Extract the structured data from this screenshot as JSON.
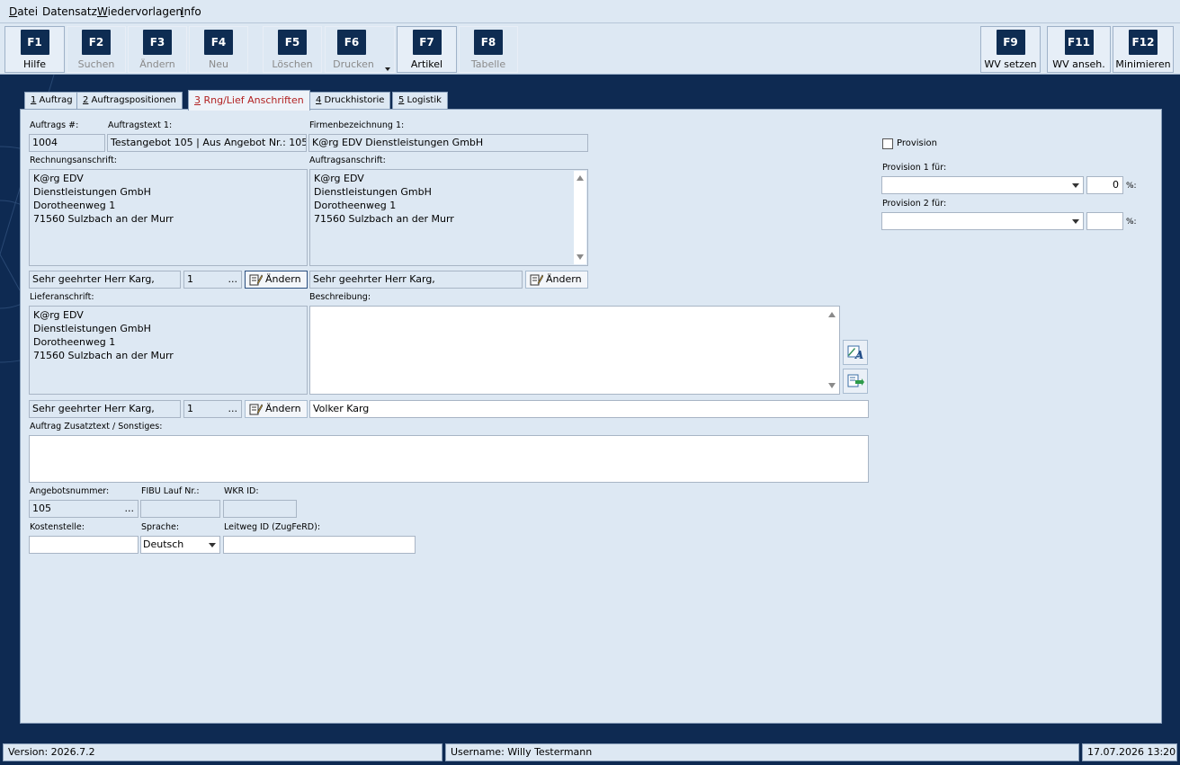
{
  "menu": {
    "items": [
      {
        "hot": "D",
        "rest": "atei"
      },
      {
        "hot": "",
        "rest": "Datensatz"
      },
      {
        "hot": "W",
        "rest": "iedervorlagen"
      },
      {
        "hot": "I",
        "rest": "nfo"
      }
    ]
  },
  "toolbar": {
    "buttons": [
      {
        "key": "F1",
        "label": "Hilfe"
      },
      {
        "key": "F2",
        "label": "Suchen"
      },
      {
        "key": "F3",
        "label": "Ändern"
      },
      {
        "key": "F4",
        "label": "Neu"
      },
      {
        "key": "F5",
        "label": "Löschen"
      },
      {
        "key": "F6",
        "label": "Drucken"
      },
      {
        "key": "F7",
        "label": "Artikel"
      },
      {
        "key": "F8",
        "label": "Tabelle"
      },
      {
        "key": "F9",
        "label": "WV setzen"
      },
      {
        "key": "F11",
        "label": "WV anseh."
      },
      {
        "key": "F12",
        "label": "Minimieren"
      }
    ]
  },
  "tabs": [
    {
      "num": "1",
      "label": " Auftrag"
    },
    {
      "num": "2",
      "label": " Auftragspositionen"
    },
    {
      "num": "3",
      "label": " Rng/Lief Anschriften"
    },
    {
      "num": "4",
      "label": " Druckhistorie"
    },
    {
      "num": "5",
      "label": " Logistik"
    }
  ],
  "form": {
    "auftragsnr_label": "Auftrags #:",
    "auftragsnr": "1004",
    "auftragstext_label": "Auftragstext 1:",
    "auftragstext": "Testangebot 105  |  Aus Angebot Nr.: 105",
    "firma_label": "Firmenbezeichnung 1:",
    "firma": "K@rg EDV Dienstleistungen GmbH",
    "rechnung_label": "Rechnungsanschrift:",
    "rechnung_lines": [
      "K@rg EDV",
      "Dienstleistungen GmbH",
      "Dorotheenweg 1",
      "71560 Sulzbach an der Murr"
    ],
    "auftragsanschrift_label": "Auftragsanschrift:",
    "auftragsanschrift_lines": [
      "K@rg EDV",
      "Dienstleistungen GmbH",
      "Dorotheenweg 1",
      "71560 Sulzbach an der Murr"
    ],
    "anrede_rechnung": "Sehr geehrter Herr Karg,",
    "anrede_rechnung_nr": "1",
    "anrede_auftrag": "Sehr geehrter Herr Karg,",
    "aendern_label": "Ändern",
    "dots": "...",
    "liefer_label": "Lieferanschrift:",
    "liefer_lines": [
      "K@rg EDV",
      "Dienstleistungen GmbH",
      "Dorotheenweg 1",
      "71560 Sulzbach an der Murr"
    ],
    "beschreibung_label": "Beschreibung:",
    "anrede_liefer": "Sehr geehrter Herr Karg,",
    "anrede_liefer_nr": "1",
    "ansprechpartner": "Volker Karg",
    "zusatz_label": "Auftrag Zusatztext / Sonstiges:",
    "angebotsnr_label": "Angebotsnummer:",
    "angebotsnr": "105",
    "fibu_label": "FIBU Lauf Nr.:",
    "wkr_label": "WKR ID:",
    "kostenstelle_label": "Kostenstelle:",
    "sprache_label": "Sprache:",
    "sprache": "Deutsch",
    "leitweg_label": "Leitweg ID (ZugFeRD):"
  },
  "provision": {
    "checkbox_label": "Provision",
    "prov1_label": "Provision 1 für:",
    "prov1_value": "0",
    "prov2_label": "Provision 2 für:",
    "percent": "%:"
  },
  "status": {
    "version": "Version: 2026.7.2",
    "user": "Username: Willy Testermann",
    "datetime": "17.07.2026 13:20"
  }
}
